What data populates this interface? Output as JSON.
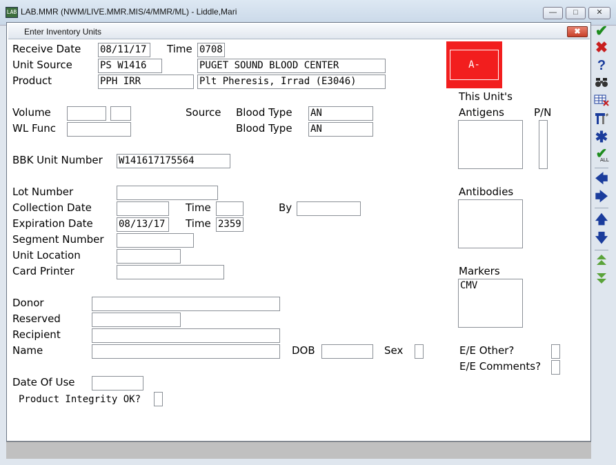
{
  "window": {
    "icon_label": "LAB",
    "title": "LAB.MMR (NWM/LIVE.MMR.MIS/4/MMR/ML) - Liddle,Mari",
    "minimize_glyph": "—",
    "maximize_glyph": "□",
    "close_glyph": "✕"
  },
  "dialog": {
    "title": "Enter Inventory Units",
    "close_glyph": "✖"
  },
  "form": {
    "receive_date_label": "Receive Date",
    "receive_date": "08/11/17",
    "time_label": "Time",
    "receive_time": "0708",
    "unit_source_label": "Unit Source",
    "unit_source_code": "PS W1416",
    "unit_source_name": "PUGET SOUND BLOOD CENTER",
    "product_label": "Product",
    "product_code": "PPH IRR",
    "product_name": "Plt Pheresis, Irrad (E3046)",
    "volume_label": "Volume",
    "volume": "",
    "volume_unit": "",
    "wl_func_label": "WL Func",
    "wl_func": "",
    "source_label": "Source",
    "blood_type_label": "Blood Type",
    "source_blood_type": "AN",
    "blood_type": "AN",
    "bbk_unit_number_label": "BBK Unit Number",
    "bbk_unit_number": "W141617175564",
    "lot_number_label": "Lot Number",
    "lot_number": "",
    "collection_date_label": "Collection Date",
    "collection_date": "",
    "collection_time": "",
    "by_label": "By",
    "by": "",
    "expiration_date_label": "Expiration Date",
    "expiration_date": "08/13/17",
    "expiration_time": "2359",
    "segment_number_label": "Segment Number",
    "segment_number": "",
    "unit_location_label": "Unit Location",
    "unit_location": "",
    "card_printer_label": "Card Printer",
    "card_printer": "",
    "donor_label": "Donor",
    "donor": "",
    "reserved_label": "Reserved",
    "reserved": "",
    "recipient_label": "Recipient",
    "recipient": "",
    "name_label": "Name",
    "name": "",
    "dob_label": "DOB",
    "dob": "",
    "sex_label": "Sex",
    "sex": "",
    "date_of_use_label": "Date Of Use",
    "date_of_use": "",
    "product_integrity_label": "Product Integrity OK?",
    "product_integrity": ""
  },
  "side": {
    "abo_rh": "A-",
    "abo_color": "#f21e1e",
    "this_units_label": "This Unit's",
    "antigens_label": "Antigens",
    "pn_label": "P/N",
    "antigens": "",
    "pn": "",
    "antibodies_label": "Antibodies",
    "antibodies": "",
    "markers_label": "Markers",
    "markers": "CMV",
    "ee_other_label": "E/E Other?",
    "ee_other": "",
    "ee_comments_label": "E/E Comments?",
    "ee_comments": ""
  },
  "toolbar": {
    "ok_icon": "checkmark-icon",
    "cancel_icon": "red-x-icon",
    "help_icon": "question-icon",
    "find_icon": "binoculars-icon",
    "all_label": "ALL",
    "accent_green": "#1e8c1e",
    "accent_blue": "#1a3c9c",
    "accent_red": "#c81e1e"
  }
}
